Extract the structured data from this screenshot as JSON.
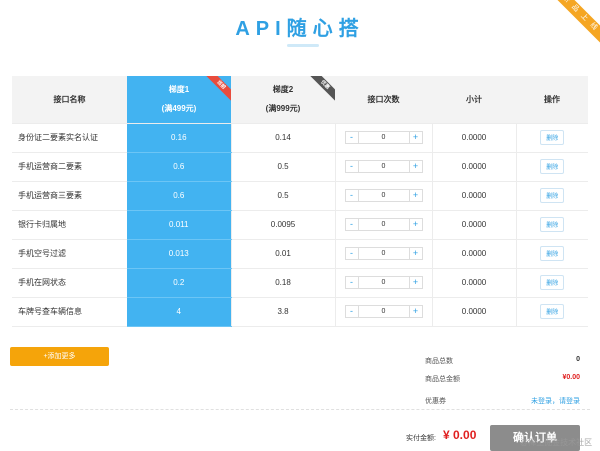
{
  "corner_ribbon": "新 品 上 线",
  "title": "API随心搭",
  "table": {
    "headers": {
      "name": "接口名称",
      "tier1": "梯度1",
      "tier1_sub": "(满499元)",
      "tier1_badge": "当前",
      "tier2": "梯度2",
      "tier2_sub": "(满999元)",
      "tier2_badge": "优惠",
      "qty": "接口次数",
      "subtotal": "小计",
      "op": "操作"
    },
    "rows": [
      {
        "name": "身份证二要素实名认证",
        "tier1": "0.16",
        "tier2": "0.14",
        "qty": "0",
        "subtotal": "0.0000",
        "op": "删除"
      },
      {
        "name": "手机运营商二要素",
        "tier1": "0.6",
        "tier2": "0.5",
        "qty": "0",
        "subtotal": "0.0000",
        "op": "删除"
      },
      {
        "name": "手机运营商三要素",
        "tier1": "0.6",
        "tier2": "0.5",
        "qty": "0",
        "subtotal": "0.0000",
        "op": "删除"
      },
      {
        "name": "银行卡归属地",
        "tier1": "0.011",
        "tier2": "0.0095",
        "qty": "0",
        "subtotal": "0.0000",
        "op": "删除"
      },
      {
        "name": "手机空号过滤",
        "tier1": "0.013",
        "tier2": "0.01",
        "qty": "0",
        "subtotal": "0.0000",
        "op": "删除"
      },
      {
        "name": "手机在网状态",
        "tier1": "0.2",
        "tier2": "0.18",
        "qty": "0",
        "subtotal": "0.0000",
        "op": "删除"
      },
      {
        "name": "车牌号查车辆信息",
        "tier1": "4",
        "tier2": "3.8",
        "qty": "0",
        "subtotal": "0.0000",
        "op": "删除"
      }
    ],
    "stepper_minus": "-",
    "stepper_plus": "+"
  },
  "add_more": "+添加更多",
  "summary": {
    "count_label": "商品总数",
    "count_value": "0",
    "total_label": "商品总金额",
    "total_value": "¥0.00",
    "coupon_label": "优惠券",
    "coupon_value": "未登录，请登录"
  },
  "pay": {
    "label": "实付金额:",
    "value": "¥ 0.00",
    "confirm": "确认订单"
  },
  "watermark": "@稀土掘金技术社区",
  "colors": {
    "accent": "#2fa0e3",
    "tier1_bg": "#42b3f1",
    "orange": "#f5a40a",
    "price_red": "#e02020"
  }
}
